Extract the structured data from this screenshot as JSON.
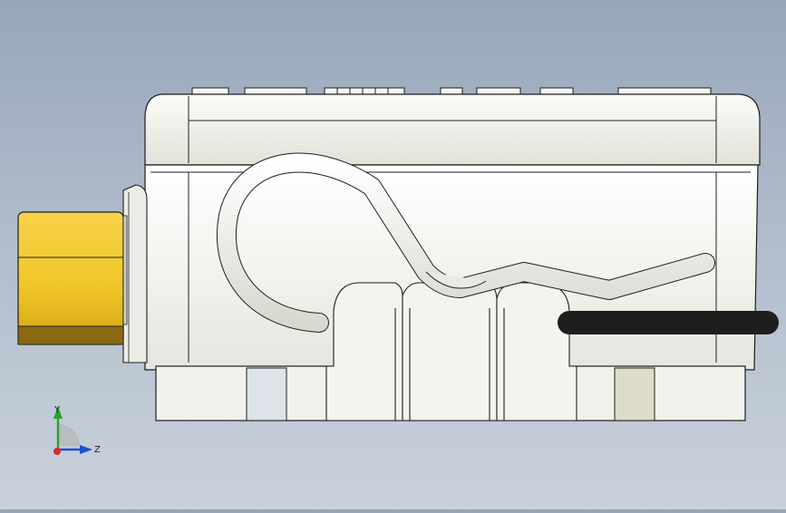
{
  "viewport": {
    "background_top": "#97a6bb",
    "background_bottom": "#c9d1dc"
  },
  "model": {
    "body_color": "#f1f1ec",
    "edge_color": "#1e1e1e",
    "fitting_color": "#f2c62a",
    "fitting_shadow_color": "#8a6a10",
    "cable_color": "#ecece6",
    "panel_accent_left": "#dde3e8",
    "panel_accent_right": "#dcdcc8"
  },
  "triad": {
    "y_label": "Y",
    "z_label": "Z",
    "y_color": "#2aa22a",
    "z_color": "#1f4fd6",
    "x_color": "#d62a2a"
  }
}
